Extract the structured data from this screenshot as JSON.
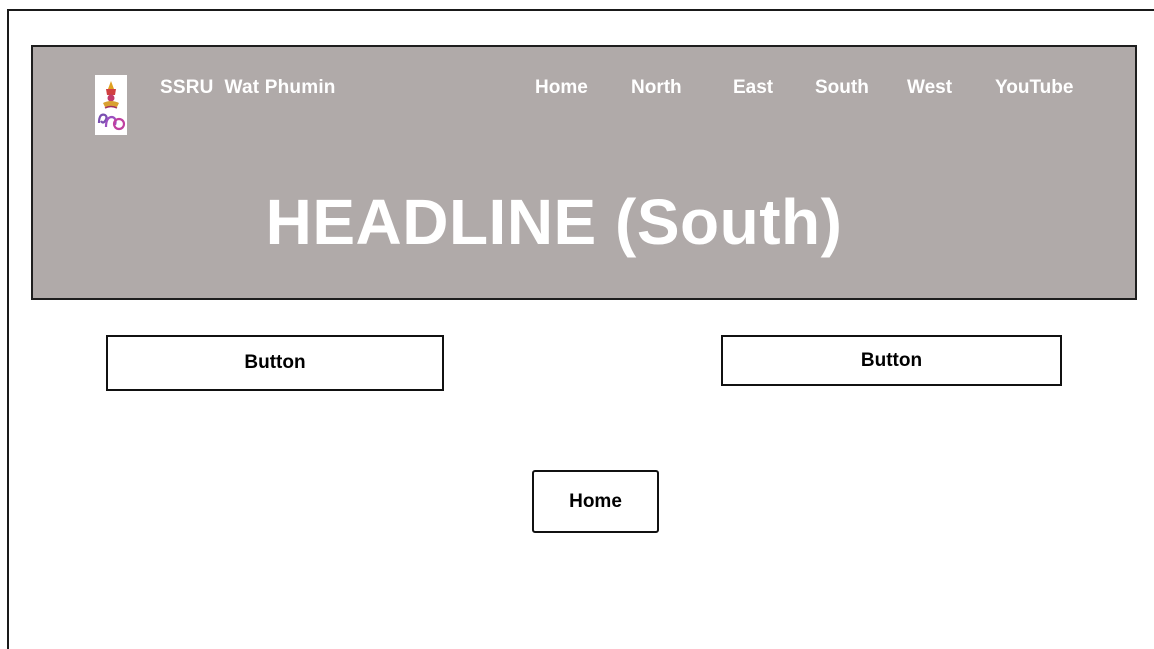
{
  "header": {
    "logo_icon": "ssru-logo-icon",
    "brand_name": "SSRU  Wat Phumin",
    "background_color": "#b0aaa9",
    "text_color": "#ffffff",
    "nav": [
      {
        "label": "Home"
      },
      {
        "label": "North"
      },
      {
        "label": "East"
      },
      {
        "label": "South"
      },
      {
        "label": "West"
      },
      {
        "label": "YouTube"
      }
    ],
    "headline": "HEADLINE (South)"
  },
  "buttons": {
    "left_label": "Button",
    "right_label": "Button",
    "home_label": "Home"
  }
}
